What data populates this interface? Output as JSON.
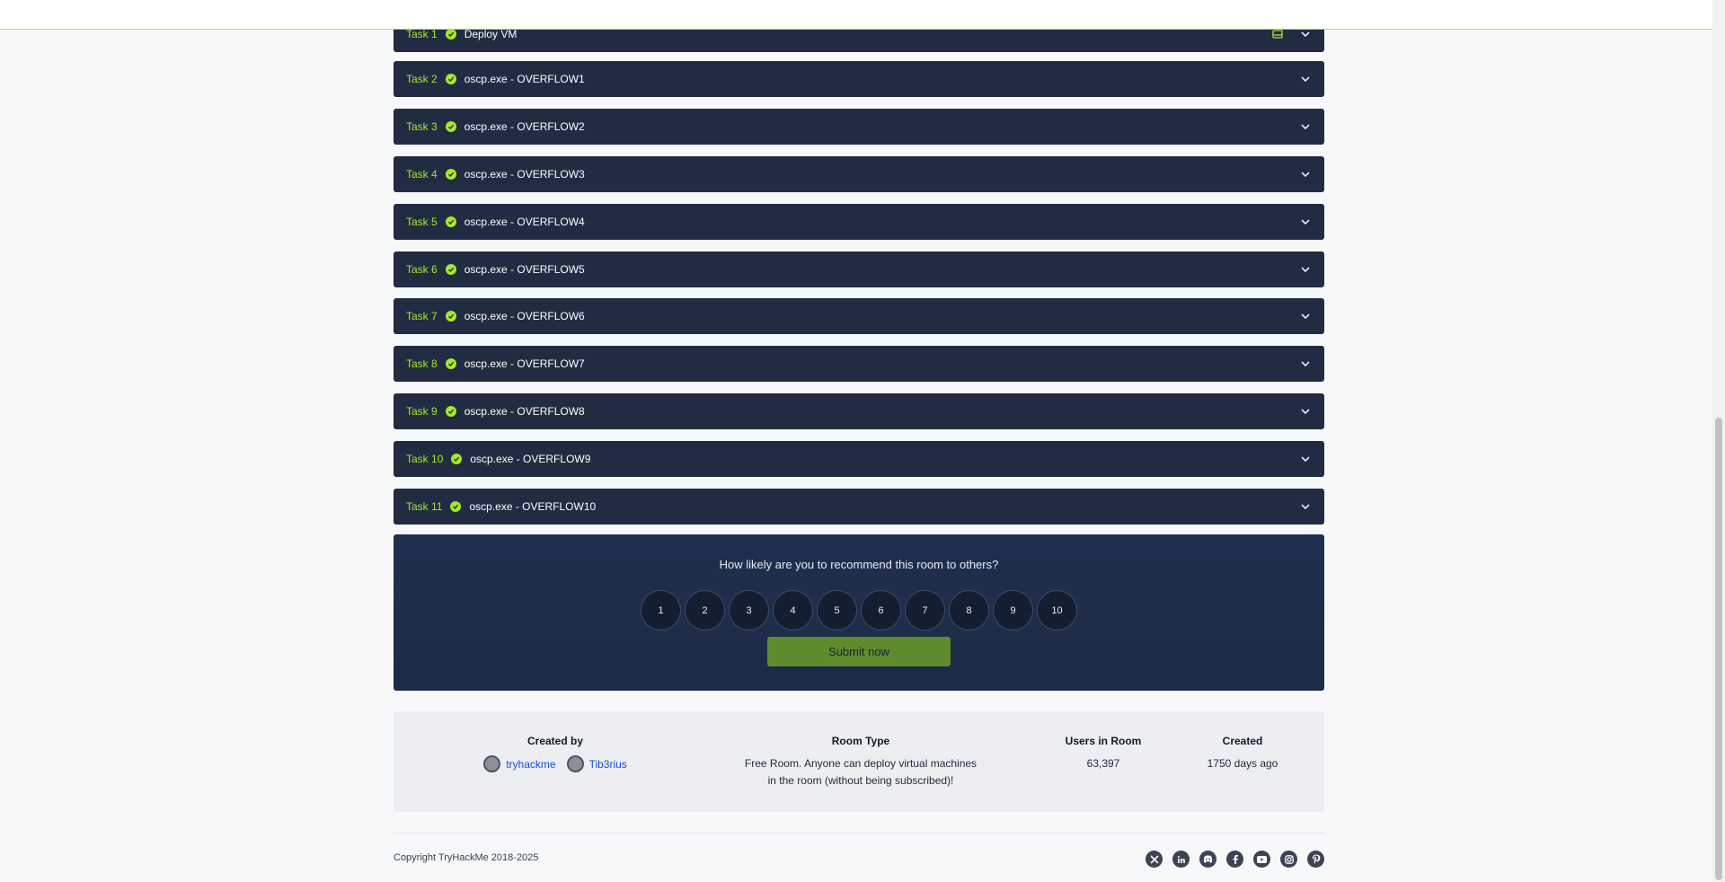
{
  "tasks": [
    {
      "number": "Task 1",
      "title": "Deploy VM"
    },
    {
      "number": "Task 2",
      "title": "oscp.exe - OVERFLOW1"
    },
    {
      "number": "Task 3",
      "title": "oscp.exe - OVERFLOW2"
    },
    {
      "number": "Task 4",
      "title": "oscp.exe - OVERFLOW3"
    },
    {
      "number": "Task 5",
      "title": "oscp.exe - OVERFLOW4"
    },
    {
      "number": "Task 6",
      "title": "oscp.exe - OVERFLOW5"
    },
    {
      "number": "Task 7",
      "title": "oscp.exe - OVERFLOW6"
    },
    {
      "number": "Task 8",
      "title": "oscp.exe - OVERFLOW7"
    },
    {
      "number": "Task 9",
      "title": "oscp.exe - OVERFLOW8"
    },
    {
      "number": "Task 10",
      "title": "oscp.exe - OVERFLOW9"
    },
    {
      "number": "Task 11",
      "title": "oscp.exe - OVERFLOW10"
    }
  ],
  "rating": {
    "question": "How likely are you to recommend this room to others?",
    "options": [
      "1",
      "2",
      "3",
      "4",
      "5",
      "6",
      "7",
      "8",
      "9",
      "10"
    ],
    "submit_label": "Submit now"
  },
  "room_info": {
    "created_by_label": "Created by",
    "creators": [
      "tryhackme",
      "Tib3rius"
    ],
    "room_type_label": "Room Type",
    "room_type_line1": "Free Room. Anyone can deploy virtual machines",
    "room_type_line2": "in the room (without being subscribed)!",
    "users_label": "Users in Room",
    "users_value": "63,397",
    "created_label": "Created",
    "created_value": "1750 days ago"
  },
  "footer": {
    "copyright": "Copyright TryHackMe 2018-2025",
    "socials": [
      "x-icon",
      "linkedin-icon",
      "discord-icon",
      "facebook-icon",
      "youtube-icon",
      "instagram-icon",
      "pinterest-icon"
    ]
  },
  "colors": {
    "accent": "#a3ea2a",
    "task_bg": "#212c42",
    "submit_bg": "#5f8b2c"
  }
}
